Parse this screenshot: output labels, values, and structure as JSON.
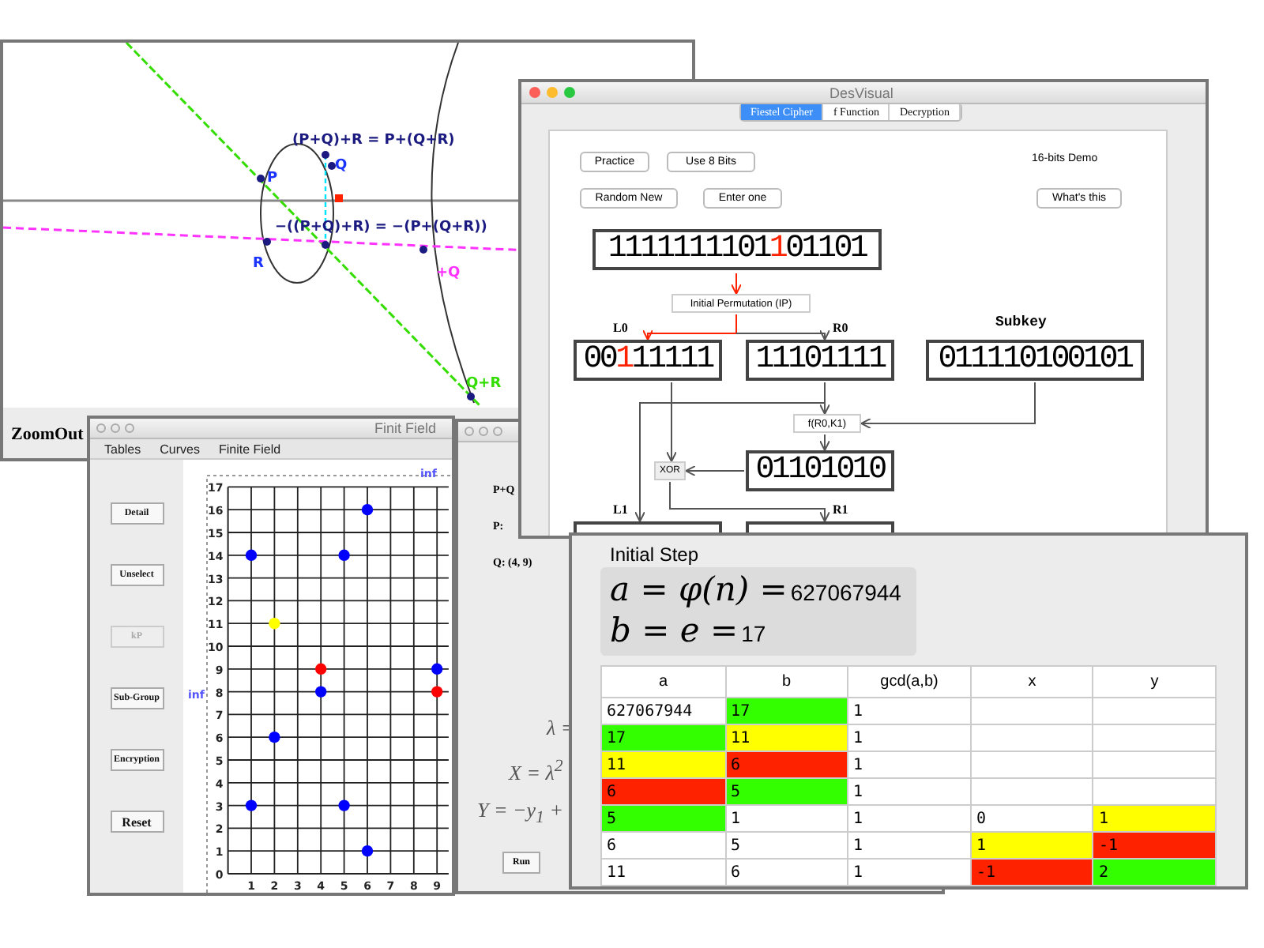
{
  "curve_window": {
    "labels": [
      {
        "text": "(P+Q)+R = P+(Q+R)",
        "color": "#1a1a80"
      },
      {
        "text": "P",
        "color": "#1a33ff"
      },
      {
        "text": "Q",
        "color": "#1a33ff"
      },
      {
        "text": "−((P+Q)+R) = −(P+(Q+R))",
        "color": "#1a1a80"
      },
      {
        "text": "R",
        "color": "#1a33ff"
      },
      {
        "text": "+Q",
        "color": "#ff33ff"
      },
      {
        "text": "Q+R",
        "color": "#33dd00"
      }
    ],
    "zoom_button": "ZoomOut"
  },
  "finite_field": {
    "title": "Finit Field",
    "menu": [
      "Tables",
      "Curves",
      "Finite Field"
    ],
    "buttons": [
      {
        "label": "Detail",
        "disabled": false
      },
      {
        "label": "Unselect",
        "disabled": false
      },
      {
        "label": "kP",
        "disabled": true
      },
      {
        "label": "Sub-Group",
        "disabled": false
      },
      {
        "label": "Encryption",
        "disabled": false
      },
      {
        "label": "Reset",
        "disabled": false
      }
    ],
    "inf_labels": [
      "inf",
      "inf"
    ],
    "chart_data": {
      "type": "scatter",
      "grid": true,
      "xlim": [
        0,
        9.5
      ],
      "ylim": [
        0,
        17
      ],
      "xticks": [
        1,
        2,
        3,
        4,
        5,
        6,
        7,
        8,
        9
      ],
      "yticks": [
        0,
        1,
        2,
        3,
        4,
        5,
        6,
        7,
        8,
        9,
        10,
        11,
        12,
        13,
        14,
        15,
        16,
        17
      ],
      "series": [
        {
          "color": "#0000ff",
          "x": [
            1,
            5,
            6,
            4,
            9,
            2,
            1,
            5,
            6
          ],
          "values": [
            14,
            14,
            16,
            8,
            9,
            6,
            3,
            3,
            1
          ]
        },
        {
          "color": "#ffff00",
          "x": [
            2
          ],
          "values": [
            11
          ]
        },
        {
          "color": "#ff0000",
          "x": [
            4,
            9
          ],
          "values": [
            9,
            8
          ]
        }
      ]
    }
  },
  "point_window": {
    "fields": [
      "P+Q",
      "P:",
      "Q:  (4, 9)"
    ],
    "formulas": [
      "λ =",
      "X = λ$^{2}$",
      "Y = −y$_{1}$ +"
    ],
    "run_button": "Run"
  },
  "des_window": {
    "title": "DesVisual",
    "tabs": [
      {
        "label": "Fiestel Cipher",
        "selected": true
      },
      {
        "label": "f Function",
        "selected": false
      },
      {
        "label": "Decryption",
        "selected": false
      }
    ],
    "buttons": [
      "Practice",
      "Use 8 Bits",
      "Random New",
      "Enter one",
      "What's this"
    ],
    "demo_label": "16-bits Demo",
    "input_bits": {
      "segments": [
        {
          "text": "1111111101",
          "highlighted": false
        },
        {
          "text": "1",
          "highlighted": true
        },
        {
          "text": "01101",
          "highlighted": false
        }
      ]
    },
    "ip_box": "Initial Permutation (IP)",
    "l0": {
      "label": "L0",
      "segments": [
        {
          "text": "00",
          "highlighted": false
        },
        {
          "text": "1",
          "highlighted": true
        },
        {
          "text": "11111",
          "highlighted": false
        }
      ]
    },
    "r0": {
      "label": "R0",
      "segments": [
        {
          "text": "11101111",
          "highlighted": false
        }
      ]
    },
    "subkey": {
      "label": "Subkey",
      "segments": [
        {
          "text": "011110100101",
          "highlighted": false
        }
      ]
    },
    "f_box": "f(R0,K1)",
    "f_output": {
      "segments": [
        {
          "text": "01101010",
          "highlighted": false
        }
      ]
    },
    "xor_box": "XOR",
    "l1": {
      "label": "L1"
    },
    "r1": {
      "label": "R1"
    }
  },
  "initial_step": {
    "title": "Initial Step",
    "formulas": [
      {
        "math": "a = φ(n) =",
        "value": "627067944"
      },
      {
        "math": "b = e =",
        "value": "17"
      }
    ],
    "table": {
      "columns": [
        "a",
        "b",
        "gcd(a,b)",
        "x",
        "y"
      ],
      "rows": [
        [
          {
            "text": "627067944"
          },
          {
            "text": "17",
            "color": "#33ff00"
          },
          {
            "text": "1"
          },
          {},
          {}
        ],
        [
          {
            "text": "17",
            "color": "#33ff00"
          },
          {
            "text": "11",
            "color": "#ffff00"
          },
          {
            "text": "1"
          },
          {},
          {}
        ],
        [
          {
            "text": "11",
            "color": "#ffff00"
          },
          {
            "text": "6",
            "color": "#ff2200"
          },
          {
            "text": "1"
          },
          {},
          {}
        ],
        [
          {
            "text": "6",
            "color": "#ff2200"
          },
          {
            "text": "5",
            "color": "#33ff00"
          },
          {
            "text": "1"
          },
          {},
          {}
        ],
        [
          {
            "text": "5",
            "color": "#33ff00"
          },
          {
            "text": "1"
          },
          {
            "text": "1"
          },
          {
            "text": "0"
          },
          {
            "text": "1",
            "color": "#ffff00"
          }
        ],
        [
          {
            "text": "6"
          },
          {
            "text": "5"
          },
          {
            "text": "1"
          },
          {
            "text": "1",
            "color": "#ffff00"
          },
          {
            "text": "-1",
            "color": "#ff2200"
          }
        ],
        [
          {
            "text": "11"
          },
          {
            "text": "6"
          },
          {
            "text": "1"
          },
          {
            "text": "-1",
            "color": "#ff2200"
          },
          {
            "text": "2",
            "color": "#33ff00"
          }
        ]
      ]
    }
  }
}
